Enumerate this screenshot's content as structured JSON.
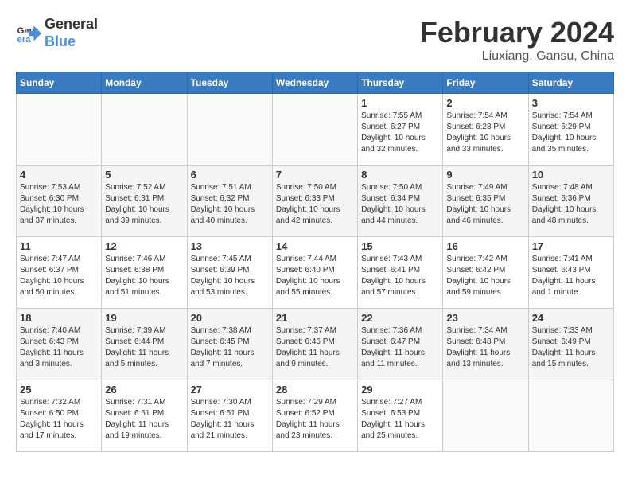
{
  "logo": {
    "text_general": "General",
    "text_blue": "Blue"
  },
  "header": {
    "month": "February 2024",
    "location": "Liuxiang, Gansu, China"
  },
  "weekdays": [
    "Sunday",
    "Monday",
    "Tuesday",
    "Wednesday",
    "Thursday",
    "Friday",
    "Saturday"
  ],
  "weeks": [
    [
      {
        "day": "",
        "info": ""
      },
      {
        "day": "",
        "info": ""
      },
      {
        "day": "",
        "info": ""
      },
      {
        "day": "",
        "info": ""
      },
      {
        "day": "1",
        "info": "Sunrise: 7:55 AM\nSunset: 6:27 PM\nDaylight: 10 hours\nand 32 minutes."
      },
      {
        "day": "2",
        "info": "Sunrise: 7:54 AM\nSunset: 6:28 PM\nDaylight: 10 hours\nand 33 minutes."
      },
      {
        "day": "3",
        "info": "Sunrise: 7:54 AM\nSunset: 6:29 PM\nDaylight: 10 hours\nand 35 minutes."
      }
    ],
    [
      {
        "day": "4",
        "info": "Sunrise: 7:53 AM\nSunset: 6:30 PM\nDaylight: 10 hours\nand 37 minutes."
      },
      {
        "day": "5",
        "info": "Sunrise: 7:52 AM\nSunset: 6:31 PM\nDaylight: 10 hours\nand 39 minutes."
      },
      {
        "day": "6",
        "info": "Sunrise: 7:51 AM\nSunset: 6:32 PM\nDaylight: 10 hours\nand 40 minutes."
      },
      {
        "day": "7",
        "info": "Sunrise: 7:50 AM\nSunset: 6:33 PM\nDaylight: 10 hours\nand 42 minutes."
      },
      {
        "day": "8",
        "info": "Sunrise: 7:50 AM\nSunset: 6:34 PM\nDaylight: 10 hours\nand 44 minutes."
      },
      {
        "day": "9",
        "info": "Sunrise: 7:49 AM\nSunset: 6:35 PM\nDaylight: 10 hours\nand 46 minutes."
      },
      {
        "day": "10",
        "info": "Sunrise: 7:48 AM\nSunset: 6:36 PM\nDaylight: 10 hours\nand 48 minutes."
      }
    ],
    [
      {
        "day": "11",
        "info": "Sunrise: 7:47 AM\nSunset: 6:37 PM\nDaylight: 10 hours\nand 50 minutes."
      },
      {
        "day": "12",
        "info": "Sunrise: 7:46 AM\nSunset: 6:38 PM\nDaylight: 10 hours\nand 51 minutes."
      },
      {
        "day": "13",
        "info": "Sunrise: 7:45 AM\nSunset: 6:39 PM\nDaylight: 10 hours\nand 53 minutes."
      },
      {
        "day": "14",
        "info": "Sunrise: 7:44 AM\nSunset: 6:40 PM\nDaylight: 10 hours\nand 55 minutes."
      },
      {
        "day": "15",
        "info": "Sunrise: 7:43 AM\nSunset: 6:41 PM\nDaylight: 10 hours\nand 57 minutes."
      },
      {
        "day": "16",
        "info": "Sunrise: 7:42 AM\nSunset: 6:42 PM\nDaylight: 10 hours\nand 59 minutes."
      },
      {
        "day": "17",
        "info": "Sunrise: 7:41 AM\nSunset: 6:43 PM\nDaylight: 11 hours\nand 1 minute."
      }
    ],
    [
      {
        "day": "18",
        "info": "Sunrise: 7:40 AM\nSunset: 6:43 PM\nDaylight: 11 hours\nand 3 minutes."
      },
      {
        "day": "19",
        "info": "Sunrise: 7:39 AM\nSunset: 6:44 PM\nDaylight: 11 hours\nand 5 minutes."
      },
      {
        "day": "20",
        "info": "Sunrise: 7:38 AM\nSunset: 6:45 PM\nDaylight: 11 hours\nand 7 minutes."
      },
      {
        "day": "21",
        "info": "Sunrise: 7:37 AM\nSunset: 6:46 PM\nDaylight: 11 hours\nand 9 minutes."
      },
      {
        "day": "22",
        "info": "Sunrise: 7:36 AM\nSunset: 6:47 PM\nDaylight: 11 hours\nand 11 minutes."
      },
      {
        "day": "23",
        "info": "Sunrise: 7:34 AM\nSunset: 6:48 PM\nDaylight: 11 hours\nand 13 minutes."
      },
      {
        "day": "24",
        "info": "Sunrise: 7:33 AM\nSunset: 6:49 PM\nDaylight: 11 hours\nand 15 minutes."
      }
    ],
    [
      {
        "day": "25",
        "info": "Sunrise: 7:32 AM\nSunset: 6:50 PM\nDaylight: 11 hours\nand 17 minutes."
      },
      {
        "day": "26",
        "info": "Sunrise: 7:31 AM\nSunset: 6:51 PM\nDaylight: 11 hours\nand 19 minutes."
      },
      {
        "day": "27",
        "info": "Sunrise: 7:30 AM\nSunset: 6:51 PM\nDaylight: 11 hours\nand 21 minutes."
      },
      {
        "day": "28",
        "info": "Sunrise: 7:29 AM\nSunset: 6:52 PM\nDaylight: 11 hours\nand 23 minutes."
      },
      {
        "day": "29",
        "info": "Sunrise: 7:27 AM\nSunset: 6:53 PM\nDaylight: 11 hours\nand 25 minutes."
      },
      {
        "day": "",
        "info": ""
      },
      {
        "day": "",
        "info": ""
      }
    ]
  ]
}
